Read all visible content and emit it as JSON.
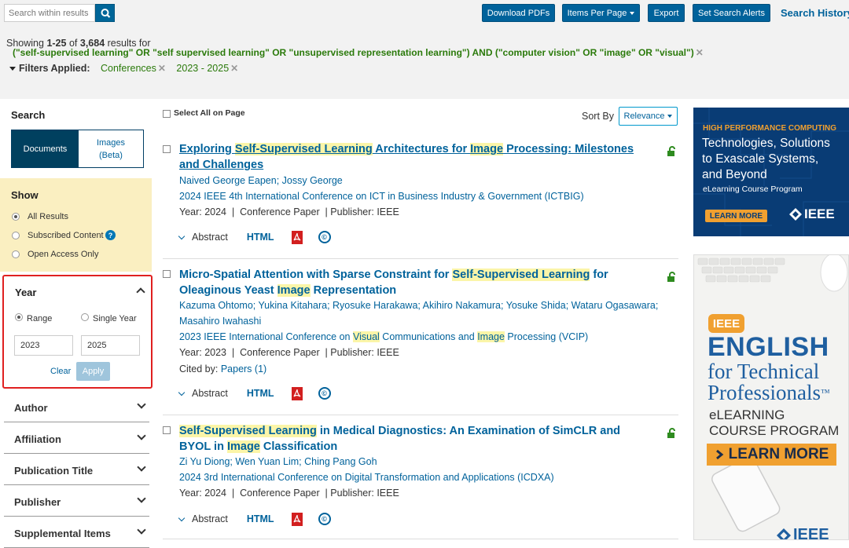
{
  "toolbar": {
    "search_placeholder": "Search within results",
    "download_pdfs": "Download PDFs",
    "items_per_page": "Items Per Page",
    "export": "Export",
    "set_search_alerts": "Set Search Alerts",
    "search_history": "Search History"
  },
  "summary": {
    "showing_prefix": "Showing",
    "range": "1-25",
    "of": "of",
    "total": "3,684",
    "suffix": "results for",
    "query": "(\"self-supervised learning\" OR \"self supervised learning\" OR \"unsupervised representation learning\") AND (\"computer vision\" OR \"image\" OR \"visual\")",
    "filters_label": "Filters Applied:",
    "filters": [
      "Conferences",
      "2023 - 2025"
    ]
  },
  "sidebar": {
    "search_title": "Search",
    "documents": "Documents",
    "images": "Images",
    "images_beta": "(Beta)",
    "show_title": "Show",
    "show_options": [
      "All Results",
      "Subscribed Content",
      "Open Access Only"
    ],
    "year_title": "Year",
    "range_label": "Range",
    "single_year_label": "Single Year",
    "year_from": "2023",
    "year_to": "2025",
    "clear": "Clear",
    "apply": "Apply",
    "facets": [
      "Author",
      "Affiliation",
      "Publication Title",
      "Publisher",
      "Supplemental Items"
    ]
  },
  "results_header": {
    "select_all": "Select All on Page",
    "sort_by": "Sort By",
    "sort_value": "Relevance"
  },
  "results": [
    {
      "title_parts": [
        {
          "t": "Exploring ",
          "h": false
        },
        {
          "t": "Self-Supervised Learning",
          "h": true
        },
        {
          "t": " Architectures for ",
          "h": false
        },
        {
          "t": "Image",
          "h": true
        },
        {
          "t": " Processing: Milestones and Challenges",
          "h": false
        }
      ],
      "authors": "Naived George Eapen; Jossy George",
      "venue": "2024 IEEE 4th International Conference on ICT in Business Industry & Government (ICTBIG)",
      "year": "Year: 2024",
      "type": "Conference Paper",
      "publisher": "Publisher: IEEE",
      "cited": ""
    },
    {
      "title_parts": [
        {
          "t": "Micro-Spatial Attention with Sparse Constraint for ",
          "h": false
        },
        {
          "t": "Self-Supervised Learning",
          "h": true
        },
        {
          "t": " for Oleaginous Yeast ",
          "h": false
        },
        {
          "t": "Image",
          "h": true
        },
        {
          "t": " Representation",
          "h": false
        }
      ],
      "authors": "Kazuma Ohtomo; Yukina Kitahara; Ryosuke Harakawa; Akihiro Nakamura; Yosuke Shida; Wataru Ogasawara;",
      "authors2": "Masahiro Iwahashi",
      "venue_parts": [
        {
          "t": "2023 IEEE International Conference on ",
          "h": false
        },
        {
          "t": "Visual",
          "h": true
        },
        {
          "t": " Communications and ",
          "h": false
        },
        {
          "t": "Image",
          "h": true
        },
        {
          "t": " Processing (VCIP)",
          "h": false
        }
      ],
      "year": "Year: 2023",
      "type": "Conference Paper",
      "publisher": "Publisher: IEEE",
      "cited_label": "Cited by:",
      "cited_link": "Papers (1)"
    },
    {
      "title_parts": [
        {
          "t": "Self-Supervised Learning",
          "h": true
        },
        {
          "t": " in Medical Diagnostics: An Examination of SimCLR and BYOL in ",
          "h": false
        },
        {
          "t": "Image",
          "h": true
        },
        {
          "t": " Classification",
          "h": false
        }
      ],
      "authors": "Zi Yu Diong; Wen Yuan Lim; Ching Pang Goh",
      "venue": "2024 3rd International Conference on Digital Transformation and Applications (ICDXA)",
      "year": "Year: 2024",
      "type": "Conference Paper",
      "publisher": "Publisher: IEEE"
    }
  ],
  "actions": {
    "abstract": "Abstract",
    "html": "HTML",
    "copyright": "©"
  },
  "ad1": {
    "kicker": "HIGH PERFORMANCE COMPUTING",
    "line1": "Technologies, Solutions",
    "line2": "to Exascale Systems,",
    "line3": "and Beyond",
    "sub": "eLearning Course Program",
    "cta": "LEARN MORE",
    "brand": "IEEE"
  },
  "ad2": {
    "badge": "IEEE",
    "english": "ENGLISH",
    "for_tech": "for Technical",
    "professionals": "Professionals",
    "tm": "™",
    "elearning": "eLEARNING",
    "course": "COURSE PROGRAM",
    "cta": "LEARN MORE",
    "brand": "IEEE"
  },
  "colors": {
    "brand_blue": "#00629b",
    "highlight": "#fbf5a8",
    "query_green": "#2b7a0b",
    "show_bg": "#faefc1",
    "year_border": "#e02020"
  }
}
